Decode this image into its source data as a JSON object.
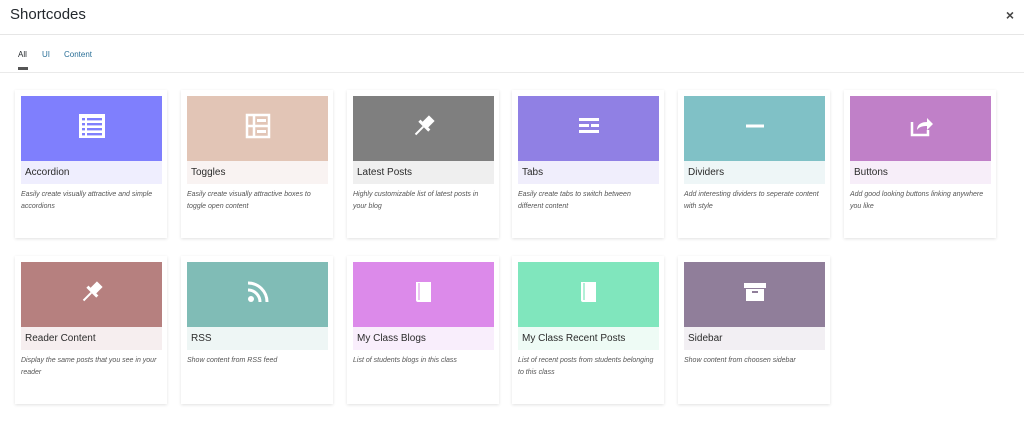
{
  "header": {
    "title": "Shortcodes",
    "close_label": "×"
  },
  "tabs": [
    {
      "label": "All",
      "active": true
    },
    {
      "label": "UI",
      "active": false
    },
    {
      "label": "Content",
      "active": false
    }
  ],
  "cards": [
    {
      "name": "Accordion",
      "icon": "list-icon",
      "color": "#7f7ffd",
      "label_bg": "#efeefe",
      "desc": "Easily create visually attractive and simple accordions"
    },
    {
      "name": "Toggles",
      "icon": "toggle-icon",
      "color": "#e2c5b6",
      "label_bg": "#f9f3f2",
      "desc": "Easily create visually attractive boxes to toggle open content"
    },
    {
      "name": "Latest Posts",
      "icon": "pin-icon",
      "color": "#7f7f7f",
      "label_bg": "#efefef",
      "desc": "Highly customizable list of latest posts in your blog"
    },
    {
      "name": "Tabs",
      "icon": "tabs-icon",
      "color": "#9080e4",
      "label_bg": "#f0eefc",
      "desc": "Easily create tabs to switch between different content"
    },
    {
      "name": "Dividers",
      "icon": "divider-icon",
      "color": "#80c1c6",
      "label_bg": "#eef6f7",
      "desc": "Add interesting dividers to seperate content with style"
    },
    {
      "name": "Buttons",
      "icon": "share-icon",
      "color": "#c080c8",
      "label_bg": "#f7eef9",
      "desc": "Add good looking buttons linking anywhere you like"
    },
    {
      "name": "Reader Content",
      "icon": "pin-icon",
      "color": "#b6807f",
      "label_bg": "#f6eeef",
      "desc": "Display the same posts that you see in your reader"
    },
    {
      "name": "RSS",
      "icon": "rss-icon",
      "color": "#80bcb6",
      "label_bg": "#eef6f5",
      "desc": "Show content from RSS feed"
    },
    {
      "name": "My Class Blogs",
      "icon": "book-icon",
      "color": "#dc8aea",
      "label_bg": "#f9eefc",
      "desc": "List of students blogs in this class"
    },
    {
      "name": "My Class Recent Posts",
      "icon": "book-icon",
      "color": "#80e6bd",
      "label_bg": "#eefbf5",
      "desc": "List of recent posts from students belonging to this class"
    },
    {
      "name": "Sidebar",
      "icon": "archive-icon",
      "color": "#907e9a",
      "label_bg": "#f2eff3",
      "desc": "Show content from choosen sidebar"
    }
  ]
}
